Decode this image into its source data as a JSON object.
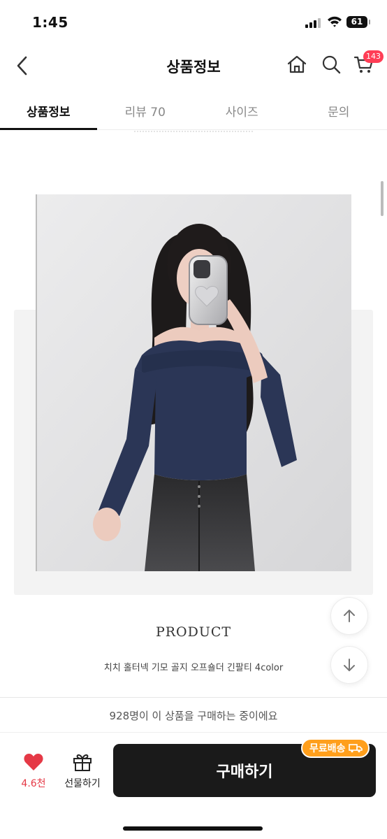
{
  "status_bar": {
    "time": "1:45",
    "battery": "61"
  },
  "header": {
    "title": "상품정보",
    "icons": {
      "back": "chevron-left-icon",
      "home": "home-icon",
      "search": "search-icon",
      "cart": "cart-icon"
    },
    "cart_count": "143"
  },
  "tabs": [
    {
      "label": "상품정보",
      "active": true
    },
    {
      "label": "리뷰 70",
      "active": false
    },
    {
      "label": "사이즈",
      "active": false
    },
    {
      "label": "문의",
      "active": false
    }
  ],
  "content": {
    "product_heading": "PRODUCT",
    "product_description": "치치 홀터넥 기모 골지 오프숄더 긴팔티 4color",
    "image_subject": "model-mirror-selfie-photo"
  },
  "float_buttons": {
    "up": "arrow-up-icon",
    "down": "arrow-down-icon"
  },
  "buy_notice": "928명이 이 상품을 구매하는 중이에요",
  "bottom_bar": {
    "like_count": "4.6천",
    "gift_label": "선물하기",
    "buy_label": "구매하기",
    "free_shipping_label": "무료배송"
  },
  "colors": {
    "accent_red": "#e53946",
    "badge_red": "#ff3d55",
    "buy_button": "#1a1a1a",
    "free_shipping": "#ff9f1c",
    "top_color_navy": "#2b3656"
  }
}
